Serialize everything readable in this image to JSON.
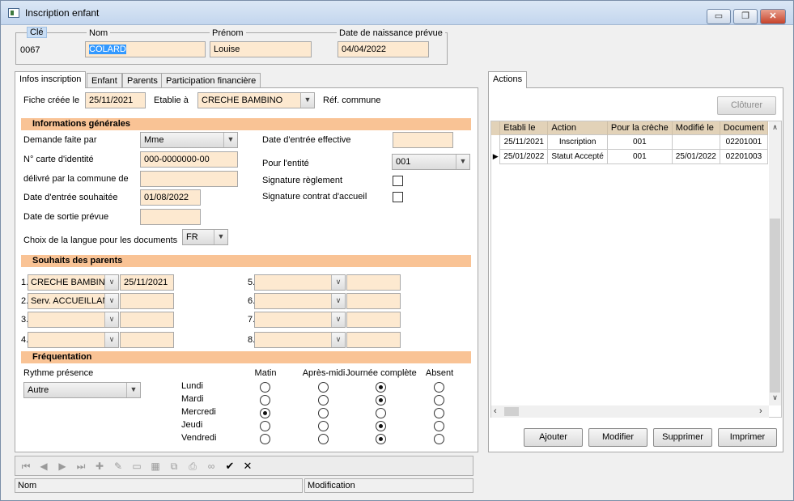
{
  "window": {
    "title": "Inscription enfant",
    "buttons": {
      "minimize": "▭",
      "restore": "❐",
      "close": "✕"
    }
  },
  "header": {
    "cle": {
      "label": "Clé",
      "value": "0067"
    },
    "nom": {
      "label": "Nom",
      "value": "COLARD"
    },
    "prenom": {
      "label": "Prénom",
      "value": "Louise"
    },
    "naissance": {
      "label": "Date de naissance prévue",
      "value": "04/04/2022"
    }
  },
  "tabs": [
    "Infos inscription",
    "Enfant",
    "Parents",
    "Participation financière"
  ],
  "top_row": {
    "fiche_label": "Fiche créée le",
    "fiche_value": "25/11/2021",
    "etablie_label": "Etablie à",
    "etablie_value": "CRECHE BAMBINO",
    "ref_label": "Réf. commune"
  },
  "sections": {
    "general": "Informations générales",
    "souhaits": "Souhaits des parents",
    "frequentation": "Fréquentation"
  },
  "general": {
    "demande_label": "Demande faite par",
    "demande_value": "Mme",
    "carte_label": "N° carte d'identité",
    "carte_value": "000-0000000-00",
    "delivre_label": "délivré par la commune de",
    "delivre_value": "",
    "entree_souhaitee_label": "Date d'entrée souhaitée",
    "entree_souhaitee_value": "01/08/2022",
    "sortie_label": "Date de sortie prévue",
    "sortie_value": "",
    "langue_label": "Choix de la langue pour les documents",
    "langue_value": "FR",
    "entree_effective_label": "Date d'entrée effective",
    "entree_effective_value": "",
    "entite_label": "Pour l'entité",
    "entite_value": "001",
    "sig_reglement_label": "Signature règlement",
    "sig_contrat_label": "Signature contrat d'accueil"
  },
  "souhaits": [
    {
      "num": "1.",
      "value": "CRECHE BAMBINO",
      "date": "25/11/2021"
    },
    {
      "num": "2.",
      "value": "Serv. ACCUEILLAN",
      "date": ""
    },
    {
      "num": "3.",
      "value": "",
      "date": ""
    },
    {
      "num": "4.",
      "value": "",
      "date": ""
    },
    {
      "num": "5.",
      "value": "",
      "date": ""
    },
    {
      "num": "6.",
      "value": "",
      "date": ""
    },
    {
      "num": "7.",
      "value": "",
      "date": ""
    },
    {
      "num": "8.",
      "value": "",
      "date": ""
    }
  ],
  "frequentation": {
    "rythme_label": "Rythme présence",
    "rythme_value": "Autre",
    "columns": [
      "Matin",
      "Après-midi",
      "Journée complète",
      "Absent"
    ],
    "days": [
      {
        "day": "Lundi",
        "selected": 2
      },
      {
        "day": "Mardi",
        "selected": 2
      },
      {
        "day": "Mercredi",
        "selected": 0
      },
      {
        "day": "Jeudi",
        "selected": 2
      },
      {
        "day": "Vendredi",
        "selected": 2
      }
    ]
  },
  "toolbar": {
    "validate": "✔",
    "cancel": "✕"
  },
  "status": {
    "nom": "Nom",
    "modification": "Modification"
  },
  "actions": {
    "tab": "Actions",
    "cloturer": "Clôturer",
    "columns": [
      "Etabli le",
      "Action",
      "Pour la crèche",
      "Modifié le",
      "Document"
    ],
    "rows": [
      {
        "etabli": "25/11/2021",
        "action": "Inscription",
        "creche": "001",
        "modifie": "",
        "document": "02201001"
      },
      {
        "etabli": "25/01/2022",
        "action": "Statut Accepté",
        "creche": "001",
        "modifie": "25/01/2022",
        "document": "02201003"
      }
    ],
    "buttons": {
      "ajouter": "Ajouter",
      "modifier": "Modifier",
      "supprimer": "Supprimer",
      "imprimer": "Imprimer"
    }
  }
}
